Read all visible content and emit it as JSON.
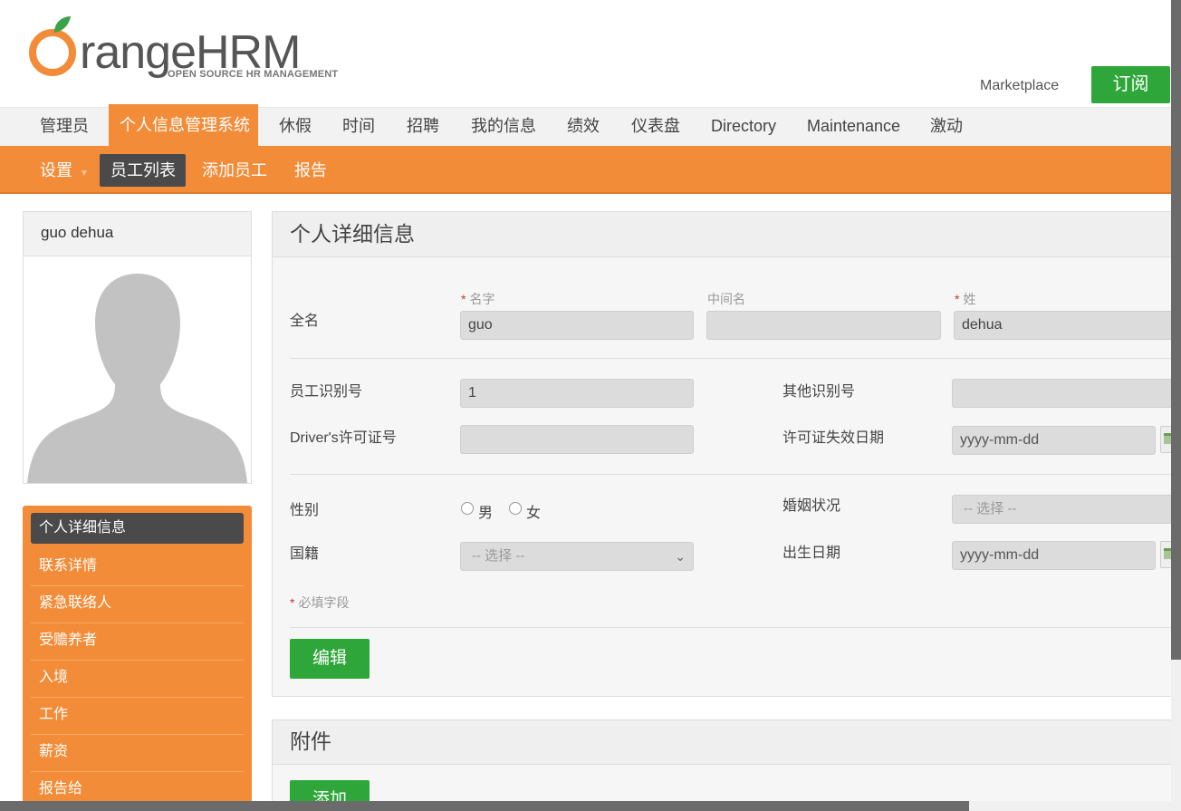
{
  "header": {
    "logo_word": "rangeHRM",
    "logo_o": "O",
    "logo_tagline": "OPEN SOURCE HR MANAGEMENT",
    "marketplace": "Marketplace",
    "subscribe": "订阅"
  },
  "main_nav": [
    {
      "label": "管理员",
      "active": false
    },
    {
      "label": "个人信息管理系统",
      "active": true
    },
    {
      "label": "休假",
      "active": false
    },
    {
      "label": "时间",
      "active": false
    },
    {
      "label": "招聘",
      "active": false
    },
    {
      "label": "我的信息",
      "active": false
    },
    {
      "label": "绩效",
      "active": false
    },
    {
      "label": "仪表盘",
      "active": false
    },
    {
      "label": "Directory",
      "active": false
    },
    {
      "label": "Maintenance",
      "active": false
    },
    {
      "label": "激动",
      "active": false
    }
  ],
  "sub_nav": [
    {
      "label": "设置",
      "active": false,
      "has_caret": true
    },
    {
      "label": "员工列表",
      "active": true
    },
    {
      "label": "添加员工",
      "active": false
    },
    {
      "label": "报告",
      "active": false
    }
  ],
  "profile": {
    "name": "guo dehua"
  },
  "side_menu": [
    {
      "label": "个人详细信息",
      "active": true
    },
    {
      "label": "联系详情",
      "active": false
    },
    {
      "label": "紧急联络人",
      "active": false
    },
    {
      "label": "受赡养者",
      "active": false
    },
    {
      "label": "入境",
      "active": false
    },
    {
      "label": "工作",
      "active": false
    },
    {
      "label": "薪资",
      "active": false
    },
    {
      "label": "报告给",
      "active": false
    }
  ],
  "details": {
    "title": "个人详细信息",
    "full_name_label": "全名",
    "first_name_label": "名字",
    "middle_name_label": "中间名",
    "last_name_label": "姓",
    "first_name": "guo",
    "middle_name": "",
    "last_name": "dehua",
    "employee_id_label": "员工识别号",
    "employee_id": "1",
    "other_id_label": "其他识别号",
    "other_id": "",
    "license_label": "Driver's许可证号",
    "license_no": "",
    "license_expiry_label": "许可证失效日期",
    "license_expiry_placeholder": "yyyy-mm-dd",
    "gender_label": "性别",
    "gender_male": "男",
    "gender_female": "女",
    "marital_label": "婚姻状况",
    "marital_value": "-- 选择 --",
    "nationality_label": "国籍",
    "nationality_value": "-- 选择 --",
    "dob_label": "出生日期",
    "dob_placeholder": "yyyy-mm-dd",
    "required_note": "必填字段",
    "required_star": "*",
    "edit_button": "编辑"
  },
  "attachments": {
    "title": "附件",
    "add_button": "添加"
  },
  "colors": {
    "accent": "#f28c38",
    "active_dark": "#4a4a4a",
    "button_green": "#2ea63a"
  }
}
